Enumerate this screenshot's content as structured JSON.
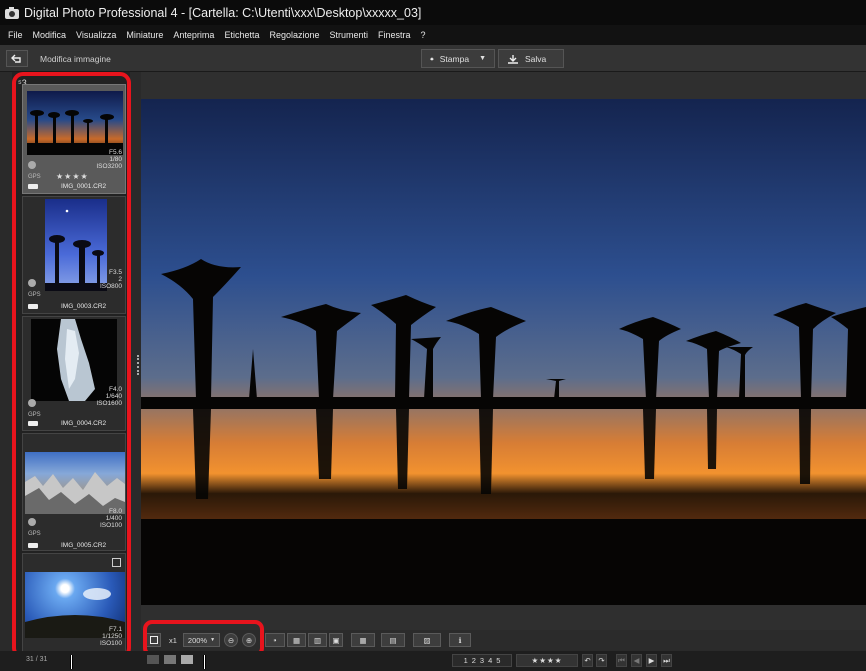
{
  "window": {
    "title": "Digital Photo Professional 4 - [Cartella: C:\\Utenti\\xxx\\Desktop\\xxxxx_03]"
  },
  "menu": [
    "File",
    "Modifica",
    "Visualizza",
    "Miniature",
    "Anteprima",
    "Etichetta",
    "Regolazione",
    "Strumenti",
    "Finestra",
    "?"
  ],
  "toolbar": {
    "mode_label": "Modifica immagine",
    "print_label": "Stampa",
    "save_label": "Salva"
  },
  "sidebar": {
    "count_badge": "3",
    "thumbnails": [
      {
        "exposure": [
          "F5.6",
          "1/80",
          "ISO3200"
        ],
        "gps": "GPS",
        "stars": "★★★★",
        "file": "IMG_0001.CR2",
        "selected": true
      },
      {
        "exposure": [
          "F3.5",
          "2",
          "ISO800"
        ],
        "gps": "GPS",
        "file": "IMG_0003.CR2"
      },
      {
        "exposure": [
          "F4.0",
          "1/640",
          "ISO1600"
        ],
        "gps": "GPS",
        "file": "IMG_0004.CR2"
      },
      {
        "exposure": [
          "F8.0",
          "1/400",
          "ISO100"
        ],
        "gps": "GPS",
        "file": "IMG_0005.CR2"
      },
      {
        "exposure": [
          "F7.1",
          "1/1250",
          "ISO100"
        ]
      }
    ]
  },
  "zoombar": {
    "x1_label": "x1",
    "zoom_value": "200%"
  },
  "status": {
    "count": "31 / 31",
    "labels": [
      "1",
      "2",
      "3",
      "4",
      "5"
    ],
    "stars": "★★★★"
  },
  "colors": {
    "highlight": "#e8141d",
    "sky_top": "#1a2a5a",
    "sky_glow": "#f08a2a"
  }
}
